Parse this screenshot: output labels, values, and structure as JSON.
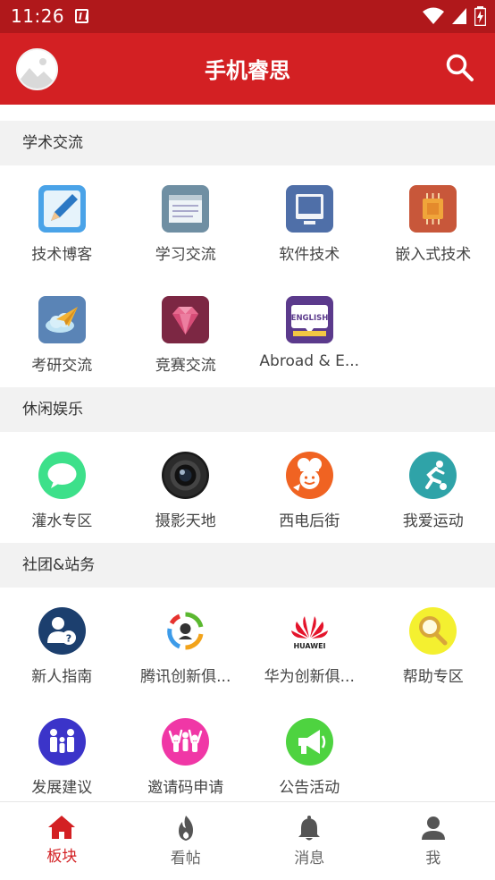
{
  "status_bar": {
    "time": "11:26"
  },
  "app_bar": {
    "title": "手机睿思",
    "search_icon": "search-icon",
    "avatar_icon": "image-placeholder-icon"
  },
  "sections": [
    {
      "title": "学术交流",
      "items": [
        {
          "label": "技术博客",
          "icon": "pencil-icon"
        },
        {
          "label": "学习交流",
          "icon": "window-icon"
        },
        {
          "label": "软件技术",
          "icon": "monitor-icon"
        },
        {
          "label": "嵌入式技术",
          "icon": "chip-icon"
        },
        {
          "label": "考研交流",
          "icon": "paper-plane-icon"
        },
        {
          "label": "竞赛交流",
          "icon": "diamond-icon"
        },
        {
          "label": "Abroad & E...",
          "icon": "english-sign-icon"
        }
      ]
    },
    {
      "title": "休闲娱乐",
      "items": [
        {
          "label": "灌水专区",
          "icon": "chat-bubble-icon"
        },
        {
          "label": "摄影天地",
          "icon": "camera-lens-icon"
        },
        {
          "label": "西电后街",
          "icon": "chef-icon"
        },
        {
          "label": "我爱运动",
          "icon": "soccer-icon"
        }
      ]
    },
    {
      "title": "社团&站务",
      "items": [
        {
          "label": "新人指南",
          "icon": "user-help-icon"
        },
        {
          "label": "腾讯创新俱...",
          "icon": "tencent-icon"
        },
        {
          "label": "华为创新俱...",
          "icon": "huawei-icon"
        },
        {
          "label": "帮助专区",
          "icon": "magnifier-icon"
        },
        {
          "label": "发展建议",
          "icon": "family-icon"
        },
        {
          "label": "邀请码申请",
          "icon": "people-cheer-icon"
        },
        {
          "label": "公告活动",
          "icon": "megaphone-icon"
        }
      ]
    }
  ],
  "huawei_logo_text": "HUAWEI",
  "english_sign_text": "ENGLISH",
  "bottom_nav": [
    {
      "label": "板块",
      "icon": "home-icon",
      "active": true
    },
    {
      "label": "看帖",
      "icon": "flame-icon",
      "active": false
    },
    {
      "label": "消息",
      "icon": "bell-icon",
      "active": false
    },
    {
      "label": "我",
      "icon": "person-icon",
      "active": false
    }
  ],
  "colors": {
    "primary": "#d32023",
    "status_bar": "#b0181b",
    "section_bg": "#f2f2f2",
    "active_nav": "#d32023"
  }
}
